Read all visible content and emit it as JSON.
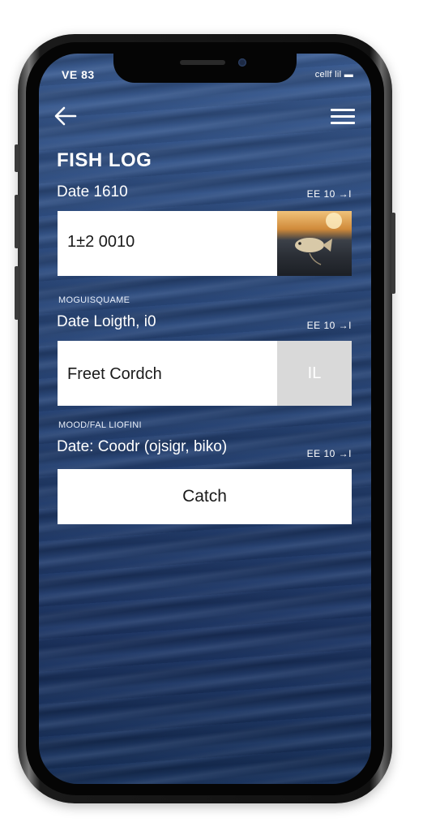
{
  "status": {
    "left": "VE 83",
    "right": "cellf lil ▬"
  },
  "header": {
    "title": "FISH LOG"
  },
  "entries": [
    {
      "label": "Date 1610",
      "meta": "EE 10 →I",
      "value": "1±2 0010"
    },
    {
      "sublabel": "MOGUISQUAME",
      "label": "Date Loigth, i0",
      "meta": "EE 10 →I",
      "value": "Freet Cordch",
      "side_text": "IL"
    },
    {
      "sublabel": "MOOD/FAL LIOFINI",
      "label": "Date: Coodr (ojsigr, biko)",
      "meta": "EE 10 →I"
    }
  ],
  "catch_button": {
    "label": "Catch"
  },
  "icons": {
    "back": "arrow-left-icon",
    "menu": "hamburger-menu-icon"
  },
  "colors": {
    "water_dark": "#17305a",
    "water_light": "#38598f",
    "card": "#ffffff",
    "grey_block": "#d9d9d9"
  }
}
